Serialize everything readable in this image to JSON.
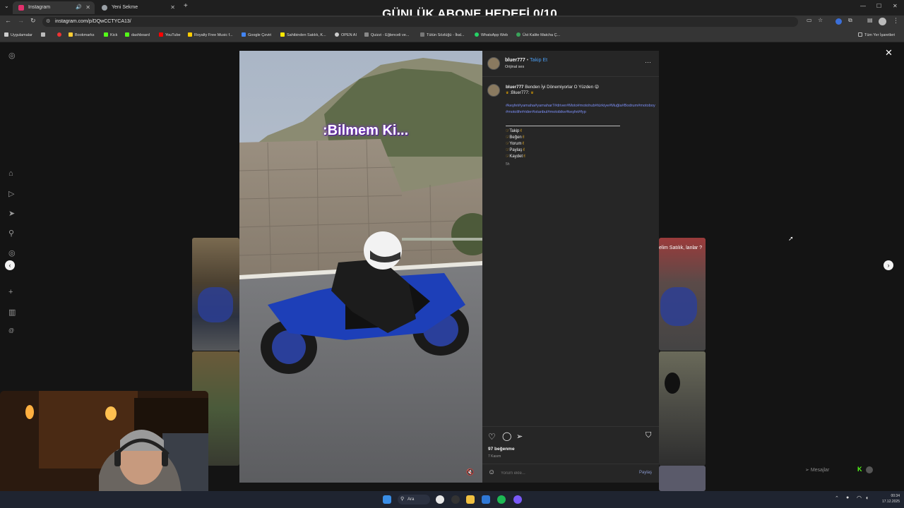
{
  "browser": {
    "tabs": [
      {
        "label": "Instagram",
        "active": true,
        "favicon_color": "#e1306c"
      },
      {
        "label": "Yeni Sekme",
        "active": false,
        "favicon_color": "#9aa0a6"
      }
    ],
    "url": "instagram.com/p/DQwCCTYCA13/",
    "bookmarks": [
      {
        "label": "Uygulamalar",
        "icon_color": "#cccccc"
      },
      {
        "label": "Bookmarks",
        "icon_color": "#ffcc33"
      },
      {
        "label": "Kick",
        "icon_color": "#53fc18"
      },
      {
        "label": "dashboard",
        "icon_color": "#53fc18"
      },
      {
        "label": "YouTube",
        "icon_color": "#ff0000"
      },
      {
        "label": "Royalty Free Music f...",
        "icon_color": "#ffcc00"
      },
      {
        "label": "Google Çeviri",
        "icon_color": "#4285f4"
      },
      {
        "label": "Sahibinden Satılık, K...",
        "icon_color": "#ffe800"
      },
      {
        "label": "OPEN AI",
        "icon_color": "#cccccc"
      },
      {
        "label": "Quizzi - Eğlenceli ve...",
        "icon_color": "#888888"
      },
      {
        "label": "Tütün Sözlüğü - İkal...",
        "icon_color": "#777777"
      },
      {
        "label": "WhatsApp Web",
        "icon_color": "#25d366"
      },
      {
        "label": "Üst Kalite Matcha Ç...",
        "icon_color": "#3aa35a"
      }
    ],
    "all_bookmarks": "Tüm Yer İşaretleri"
  },
  "overlay": {
    "title": "GÜNLÜK ABONE HEDEFİ 0/10"
  },
  "post": {
    "username": "bluer777",
    "follow_label": "Takip Et",
    "audio_label": "Orijinal ses",
    "video_caption": ":Bilmem Ki...",
    "caption_main": "Benden İyi Dönemiyorlar O Yüzden 😜",
    "caption_sub": ":Bluer777:",
    "hashtags": "#keşfet#yamaha#yamahar7#driver#Moto#motohub#türkiye#Muğla#Bodrum#motoboy#motolife#rider#istanbul#motobike#keşfet#fyp",
    "cta_items": [
      "Takip",
      "Beğen",
      "Yorum",
      "Paylaş",
      "Kaydet"
    ],
    "caption_time": "5h",
    "likes": "97 beğenme",
    "date": "7 Kasım",
    "comment_placeholder": "Yorum ekle...",
    "share_label": "Paylaş",
    "messages_label": "Mesajlar"
  },
  "thumbs": {
    "right_top_text": "elim Satılık, lanlar ?"
  },
  "taskbar": {
    "search_label": "Ara",
    "time": "00:34",
    "date": "17.12.2025"
  },
  "colors": {
    "link": "#7b8ef5",
    "accent_follow": "#4a9cf0",
    "panel": "#262626"
  }
}
